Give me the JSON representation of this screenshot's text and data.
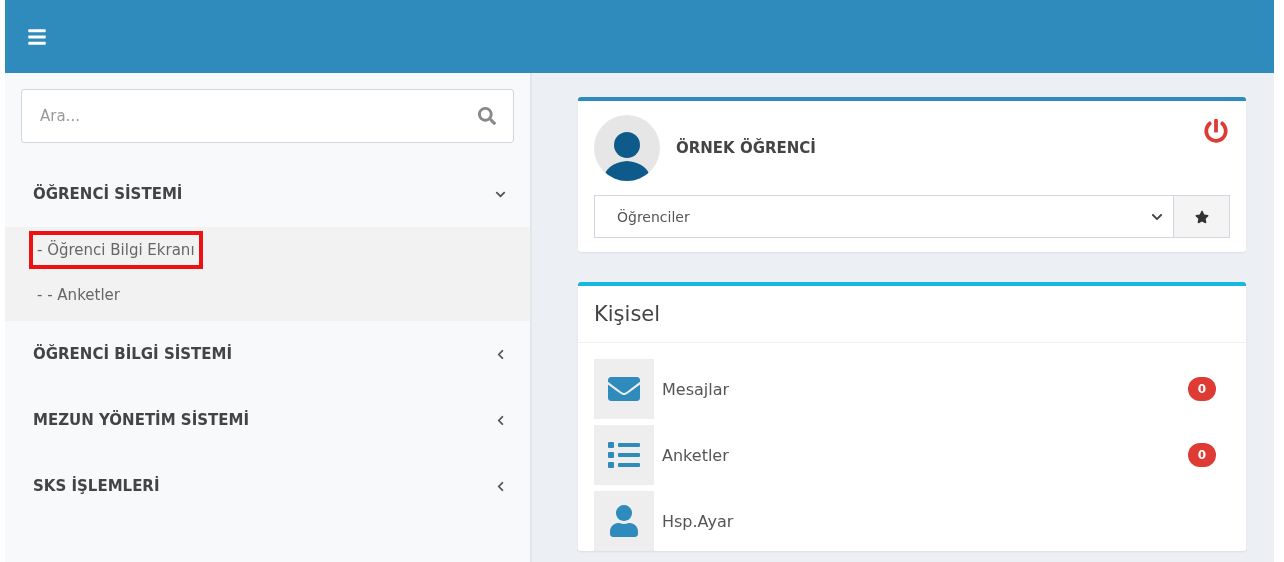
{
  "search": {
    "placeholder": "Ara..."
  },
  "menu": [
    {
      "label": "ÖĞRENCİ SİSTEMİ",
      "expanded": true,
      "children": [
        {
          "label": "- Öğrenci Bilgi Ekranı",
          "highlighted": true
        },
        {
          "label": "- - Anketler",
          "highlighted": false
        }
      ]
    },
    {
      "label": "ÖĞRENCİ BİLGİ SİSTEMİ",
      "expanded": false
    },
    {
      "label": "MEZUN YÖNETİM SİSTEMİ",
      "expanded": false
    },
    {
      "label": "SKS İŞLEMLERİ",
      "expanded": false
    }
  ],
  "profile": {
    "name": "ÖRNEK ÖĞRENCİ",
    "role_select": "Öğrenciler"
  },
  "personal": {
    "title": "Kişisel",
    "items": [
      {
        "kind": "mail",
        "label": "Mesajlar",
        "badge": "0"
      },
      {
        "kind": "list",
        "label": "Anketler",
        "badge": "0"
      },
      {
        "kind": "user",
        "label": "Hsp.Ayar"
      }
    ]
  }
}
